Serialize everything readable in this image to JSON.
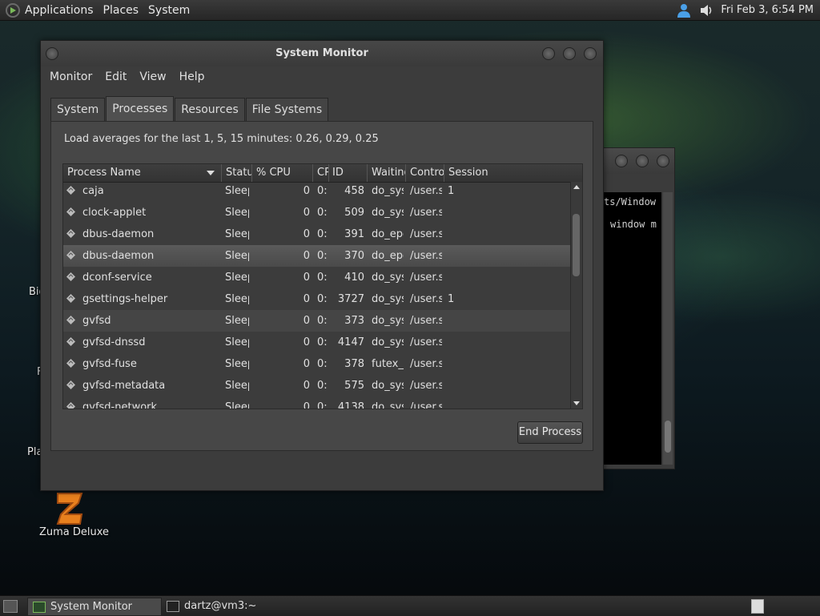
{
  "top_panel": {
    "menus": [
      "Applications",
      "Places",
      "System"
    ],
    "clock": "Fri Feb  3,  6:54 PM",
    "tray": [
      "user-icon",
      "volume-icon"
    ]
  },
  "desktop": {
    "icons": [
      "Zuma Deluxe"
    ]
  },
  "terminal_bg": {
    "lines": [
      "ts/Window",
      "",
      "window m"
    ]
  },
  "window": {
    "title": "System Monitor",
    "menu": [
      "Monitor",
      "Edit",
      "View",
      "Help"
    ],
    "tabs": [
      "System",
      "Processes",
      "Resources",
      "File Systems"
    ],
    "active_tab": "Processes",
    "load_averages": "Load averages for the last 1, 5, 15 minutes: 0.26, 0.29, 0.25",
    "columns": [
      "Process Name",
      "Status",
      "% CPU",
      "CPU",
      "ID",
      "Waiting",
      "Control",
      "Session"
    ],
    "rows": [
      {
        "name": "caja",
        "status": "Sleeping",
        "cpu": "0",
        "cputime": "0:",
        "id": "458",
        "waiting": "do_sys",
        "control": "/user.s",
        "session": "1"
      },
      {
        "name": "clock-applet",
        "status": "Sleeping",
        "cpu": "0",
        "cputime": "0:",
        "id": "509",
        "waiting": "do_sys",
        "control": "/user.s",
        "session": ""
      },
      {
        "name": "dbus-daemon",
        "status": "Sleeping",
        "cpu": "0",
        "cputime": "0:",
        "id": "391",
        "waiting": "do_epo",
        "control": "/user.s",
        "session": ""
      },
      {
        "name": "dbus-daemon",
        "status": "Sleeping",
        "cpu": "0",
        "cputime": "0:",
        "id": "370",
        "waiting": "do_epo",
        "control": "/user.s",
        "session": ""
      },
      {
        "name": "dconf-service",
        "status": "Sleeping",
        "cpu": "0",
        "cputime": "0:",
        "id": "410",
        "waiting": "do_sys",
        "control": "/user.s",
        "session": ""
      },
      {
        "name": "gsettings-helper",
        "status": "Sleeping",
        "cpu": "0",
        "cputime": "0:",
        "id": "3727",
        "waiting": "do_sys",
        "control": "/user.s",
        "session": "1"
      },
      {
        "name": "gvfsd",
        "status": "Sleeping",
        "cpu": "0",
        "cputime": "0:",
        "id": "373",
        "waiting": "do_sys",
        "control": "/user.s",
        "session": ""
      },
      {
        "name": "gvfsd-dnssd",
        "status": "Sleeping",
        "cpu": "0",
        "cputime": "0:",
        "id": "4147",
        "waiting": "do_sys",
        "control": "/user.s",
        "session": ""
      },
      {
        "name": "gvfsd-fuse",
        "status": "Sleeping",
        "cpu": "0",
        "cputime": "0:",
        "id": "378",
        "waiting": "futex_w",
        "control": "/user.s",
        "session": ""
      },
      {
        "name": "gvfsd-metadata",
        "status": "Sleeping",
        "cpu": "0",
        "cputime": "0:",
        "id": "575",
        "waiting": "do_sys",
        "control": "/user.s",
        "session": ""
      },
      {
        "name": "gvfsd-network",
        "status": "Sleeping",
        "cpu": "0",
        "cputime": "0:",
        "id": "4138",
        "waiting": "do_sys",
        "control": "/user.s",
        "session": ""
      }
    ],
    "selected_row": 3,
    "end_process_label": "End Process"
  },
  "bottom_panel": {
    "tasks": [
      "System Monitor",
      "dartz@vm3:~"
    ]
  }
}
